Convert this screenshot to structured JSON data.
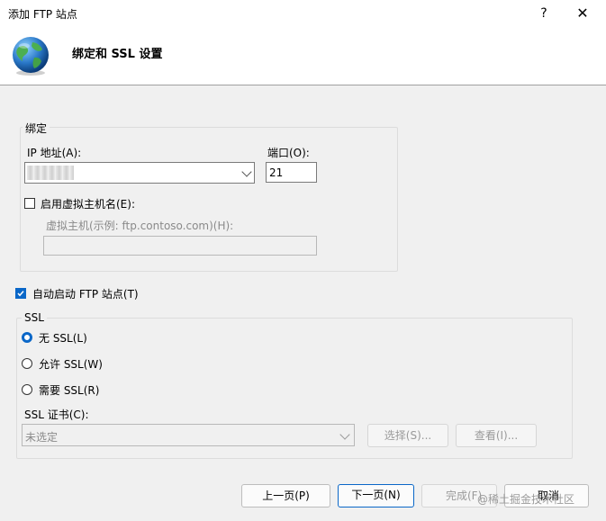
{
  "window": {
    "title": "添加 FTP 站点",
    "help_glyph": "?",
    "close_glyph": "✕"
  },
  "header": {
    "title": "绑定和 SSL 设置"
  },
  "binding": {
    "legend": "绑定",
    "ip_label": "IP 地址(A):",
    "ip_value": "",
    "port_label": "端口(O):",
    "port_value": "21",
    "virtual_host_checkbox": "启用虚拟主机名(E):",
    "virtual_host_label": "虚拟主机(示例: ftp.contoso.com)(H):",
    "virtual_host_value": ""
  },
  "auto_start": {
    "label": "自动启动 FTP 站点(T)",
    "checked": true
  },
  "ssl": {
    "legend": "SSL",
    "options": [
      "无 SSL(L)",
      "允许 SSL(W)",
      "需要 SSL(R)"
    ],
    "selected": "无 SSL(L)",
    "cert_label": "SSL 证书(C):",
    "cert_value": "未选定",
    "select_button": "选择(S)...",
    "view_button": "查看(I)..."
  },
  "footer": {
    "prev_button": "上一页(P)",
    "next_button": "下一页(N)",
    "finish_button": "完成(F)",
    "cancel_button": "取消",
    "watermark": "@稀土掘金技术社区"
  },
  "colors": {
    "accent": "#0a67c8",
    "titlebar_bg": "#ffffff",
    "body_bg": "#f0f0f0"
  },
  "icons": {
    "header_icon": "globe-icon"
  }
}
